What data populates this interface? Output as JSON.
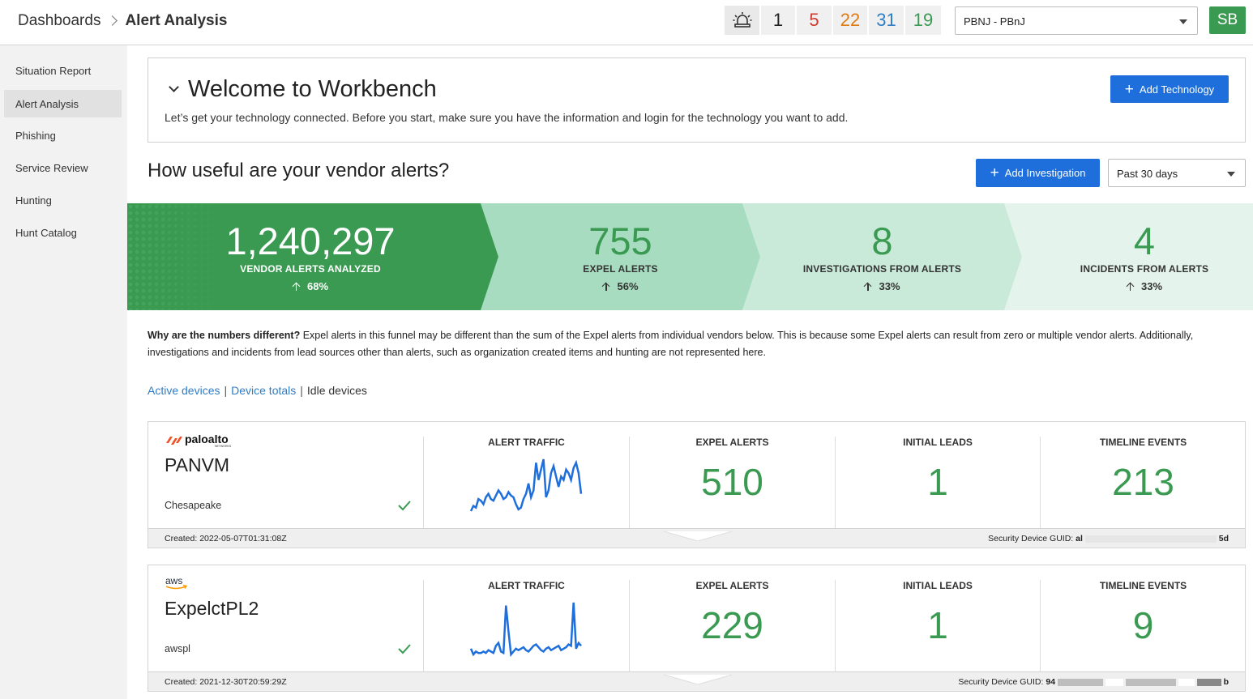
{
  "header": {
    "breadcrumb_root": "Dashboards",
    "breadcrumb_current": "Alert Analysis",
    "alarm_icon": "siren-icon",
    "counts": [
      "1",
      "5",
      "22",
      "31",
      "19"
    ],
    "count_colors": [
      "#222222",
      "#d0392b",
      "#e07b12",
      "#2f7dc6",
      "#3a9a52"
    ],
    "org_select": "PBNJ - PBnJ",
    "avatar": "SB"
  },
  "sidebar": {
    "items": [
      {
        "label": "Situation Report",
        "active": false
      },
      {
        "label": "Alert Analysis",
        "active": true
      },
      {
        "label": "Phishing",
        "active": false
      },
      {
        "label": "Service Review",
        "active": false
      },
      {
        "label": "Hunting",
        "active": false
      },
      {
        "label": "Hunt Catalog",
        "active": false
      }
    ]
  },
  "welcome": {
    "title": "Welcome to Workbench",
    "text": "Let’s get your technology connected. Before you start, make sure you have the information and login for the technology you want to add.",
    "add_technology": "Add Technology"
  },
  "vendor": {
    "question": "How useful are your vendor alerts?",
    "add_investigation": "Add Investigation",
    "range": "Past 30 days"
  },
  "funnel": [
    {
      "value": "1,240,297",
      "label": "VENDOR ALERTS ANALYZED",
      "pct": "68%",
      "color": "#3a9a52"
    },
    {
      "value": "755",
      "label": "EXPEL ALERTS",
      "pct": "56%",
      "color": "#a8dcc0"
    },
    {
      "value": "8",
      "label": "INVESTIGATIONS FROM ALERTS",
      "pct": "33%",
      "color": "#c9ead8"
    },
    {
      "value": "4",
      "label": "INCIDENTS FROM ALERTS",
      "pct": "33%",
      "color": "#e4f4ec"
    }
  ],
  "why": {
    "bold": "Why are the numbers different?",
    "text": " Expel alerts in this funnel may be different than the sum of the Expel alerts from individual vendors below. This is because some Expel alerts can result from zero or multiple vendor alerts. Additionally, investigations and incidents from lead sources other than alerts, such as organization created items and hunting are not represented here."
  },
  "device_links": {
    "active": "Active devices",
    "totals": "Device totals",
    "idle": "Idle devices"
  },
  "column_labels": {
    "traffic": "ALERT TRAFFIC",
    "expel": "EXPEL ALERTS",
    "leads": "INITIAL LEADS",
    "timeline": "TIMELINE EVENTS"
  },
  "devices": [
    {
      "logo": "paloalto",
      "logo_sub": "NETWORKS",
      "name": "PANVM",
      "location": "Chesapeake",
      "expel_alerts": "510",
      "initial_leads": "1",
      "timeline_events": "213",
      "created": "2022-05-07T01:31:08Z",
      "guid_label": "Security Device GUID:",
      "guid_start": "al",
      "guid_end": "5d",
      "traffic": [
        2,
        5,
        4,
        9,
        8,
        6,
        10,
        12,
        9,
        8,
        11,
        14,
        12,
        9,
        10,
        13,
        11,
        10,
        6,
        3,
        4,
        9,
        12,
        18,
        10,
        14,
        30,
        20,
        26,
        32,
        10,
        14,
        24,
        28,
        22,
        16,
        22,
        20,
        26,
        24,
        20,
        27,
        30,
        24,
        12
      ]
    },
    {
      "logo": "aws",
      "name": "ExpelctPL2",
      "location": "awspl",
      "expel_alerts": "229",
      "initial_leads": "1",
      "timeline_events": "9",
      "created": "2021-12-30T20:59:29Z",
      "guid_label": "Security Device GUID:",
      "guid_start": "94",
      "guid_end": "b",
      "traffic": [
        6,
        2,
        4,
        3,
        3,
        4,
        3,
        5,
        4,
        3,
        8,
        10,
        4,
        3,
        36,
        18,
        2,
        4,
        6,
        5,
        6,
        7,
        5,
        4,
        6,
        8,
        9,
        7,
        5,
        4,
        6,
        7,
        5,
        6,
        7,
        8,
        5,
        6,
        7,
        9,
        8,
        38,
        6,
        10,
        8
      ]
    }
  ]
}
